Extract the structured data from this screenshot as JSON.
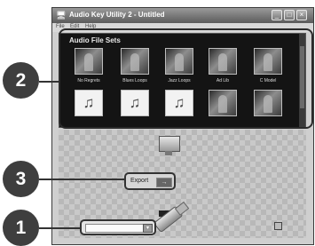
{
  "window": {
    "title": "Audio Key Utility 2 - Untitled",
    "title_icon": "🖥",
    "controls": {
      "minimize": "_",
      "maximize": "□",
      "close": "×"
    }
  },
  "menu": {
    "items": [
      "File",
      "Edit",
      "Help"
    ]
  },
  "audio_file_sets": {
    "title": "Audio File Sets",
    "tiles": [
      {
        "label": "No Regrets",
        "kind": "photo"
      },
      {
        "label": "Blues Loops",
        "kind": "photo"
      },
      {
        "label": "Jazz Loops",
        "kind": "photo"
      },
      {
        "label": "Ad Lib",
        "kind": "photo"
      },
      {
        "label": "C Model",
        "kind": "photo"
      },
      {
        "label": "",
        "kind": "note",
        "glyph": "♫"
      },
      {
        "label": "",
        "kind": "note",
        "glyph": "♫"
      },
      {
        "label": "",
        "kind": "note",
        "glyph": "♫"
      },
      {
        "label": "",
        "kind": "photo"
      },
      {
        "label": "",
        "kind": "photo"
      }
    ]
  },
  "export": {
    "label": "Export",
    "icon": "→",
    "icon_name": "export-arrow-icon"
  },
  "device": {
    "button_glyph": "▾",
    "icon_name": "usb-key-icon"
  },
  "callouts": [
    "1",
    "2",
    "3"
  ],
  "colors": {
    "panel": "#141414",
    "callout_fill": "#3e3e3e",
    "frame": "#2b2b2b"
  }
}
